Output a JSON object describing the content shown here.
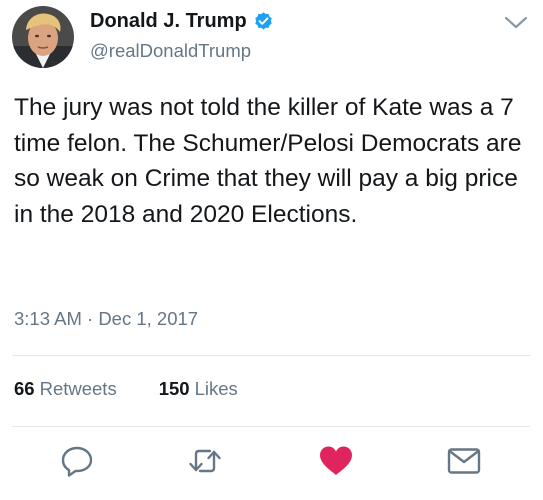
{
  "colors": {
    "text": "#14171a",
    "secondary": "#657786",
    "verified": "#1da1f2",
    "liked": "#e0245e",
    "divider": "#e1e8ed"
  },
  "tweet": {
    "author": {
      "display_name": "Donald J. Trump",
      "handle": "@realDonaldTrump",
      "verified": true
    },
    "text": "The jury was not told the killer of Kate was a 7 time felon. The Schumer/Pelosi Democrats are so weak on Crime that they will pay a big price in the 2018 and 2020 Elections.",
    "timestamp": "3:13 AM · Dec 1, 2017",
    "stats": {
      "retweets_count": "66",
      "retweets_label": "Retweets",
      "likes_count": "150",
      "likes_label": "Likes"
    },
    "actions": [
      {
        "name": "reply",
        "icon": "reply-icon"
      },
      {
        "name": "retweet",
        "icon": "retweet-icon"
      },
      {
        "name": "like",
        "icon": "heart-icon",
        "state": "liked"
      },
      {
        "name": "direct-message",
        "icon": "envelope-icon"
      }
    ]
  }
}
